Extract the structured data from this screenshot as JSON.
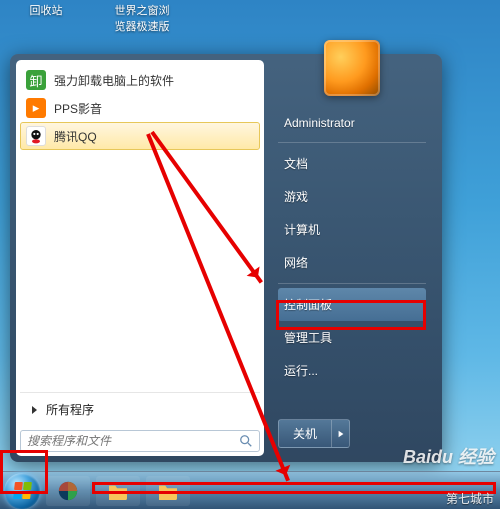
{
  "desktop": {
    "icons": [
      {
        "label": "回收站"
      },
      {
        "label": "世界之窗浏览器极速版"
      }
    ]
  },
  "start_menu": {
    "programs": [
      {
        "label": "强力卸载电脑上的软件",
        "icon": "uninstall-icon",
        "color": "#3aa13a"
      },
      {
        "label": "PPS影音",
        "icon": "pps-icon",
        "color": "#ff7a00"
      },
      {
        "label": "腾讯QQ",
        "icon": "qq-icon",
        "color": "#e11825"
      }
    ],
    "all_programs_label": "所有程序",
    "search_placeholder": "搜索程序和文件"
  },
  "right_menu": {
    "username": "Administrator",
    "items": [
      {
        "label": "文档"
      },
      {
        "label": "游戏"
      },
      {
        "label": "计算机"
      },
      {
        "label": "网络"
      },
      {
        "label": "控制面板",
        "highlighted": true
      },
      {
        "label": "管理工具"
      },
      {
        "label": "运行..."
      }
    ],
    "shutdown_label": "关机"
  },
  "watermarks": {
    "baidu": "Baidu 经验",
    "site": "第七城市"
  },
  "annotation": {
    "targets": [
      "control-panel-item",
      "start-orb"
    ]
  }
}
